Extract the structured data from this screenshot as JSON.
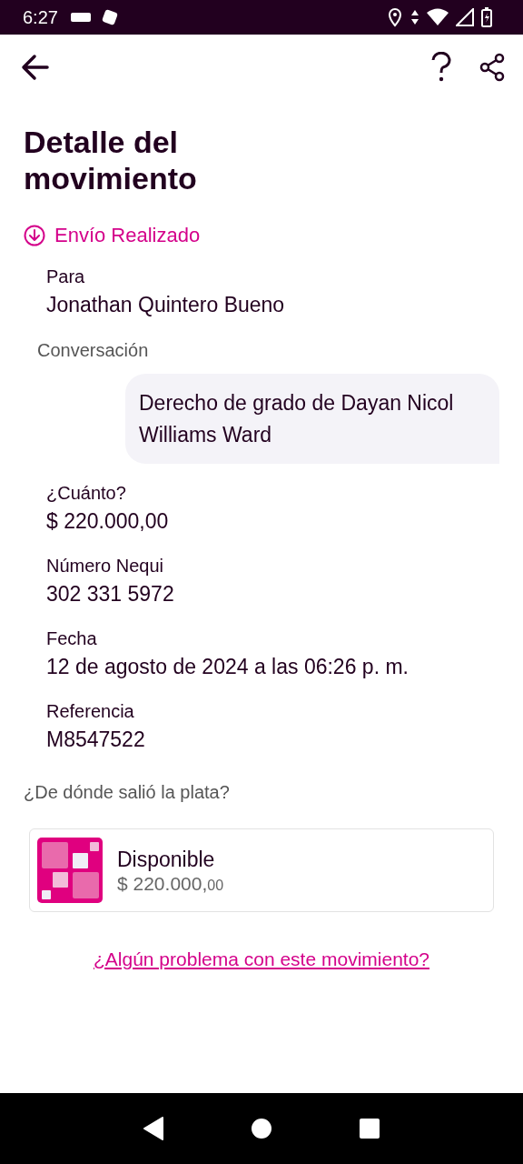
{
  "status_bar": {
    "time": "6:27"
  },
  "header": {
    "title": "Detalle del movimiento"
  },
  "status": {
    "label": "Envío Realizado"
  },
  "fields_top": [
    {
      "label": "Para",
      "value": "Jonathan Quintero Bueno"
    }
  ],
  "conversation": {
    "label": "Conversación",
    "message": "Derecho de grado de Dayan Nicol Williams Ward"
  },
  "fields": [
    {
      "label": "¿Cuánto?",
      "value": "$ 220.000,00"
    },
    {
      "label": "Número Nequi",
      "value": "302 331 5972"
    },
    {
      "label": "Fecha",
      "value": "12 de agosto de 2024 a las 06:26 p. m."
    },
    {
      "label": "Referencia",
      "value": "M8547522"
    }
  ],
  "source": {
    "label": "¿De dónde salió la plata?",
    "account": "Disponible",
    "amount": "$ 220.000,",
    "cents": "00"
  },
  "help_link": "¿Algún problema con este movimiento?"
}
